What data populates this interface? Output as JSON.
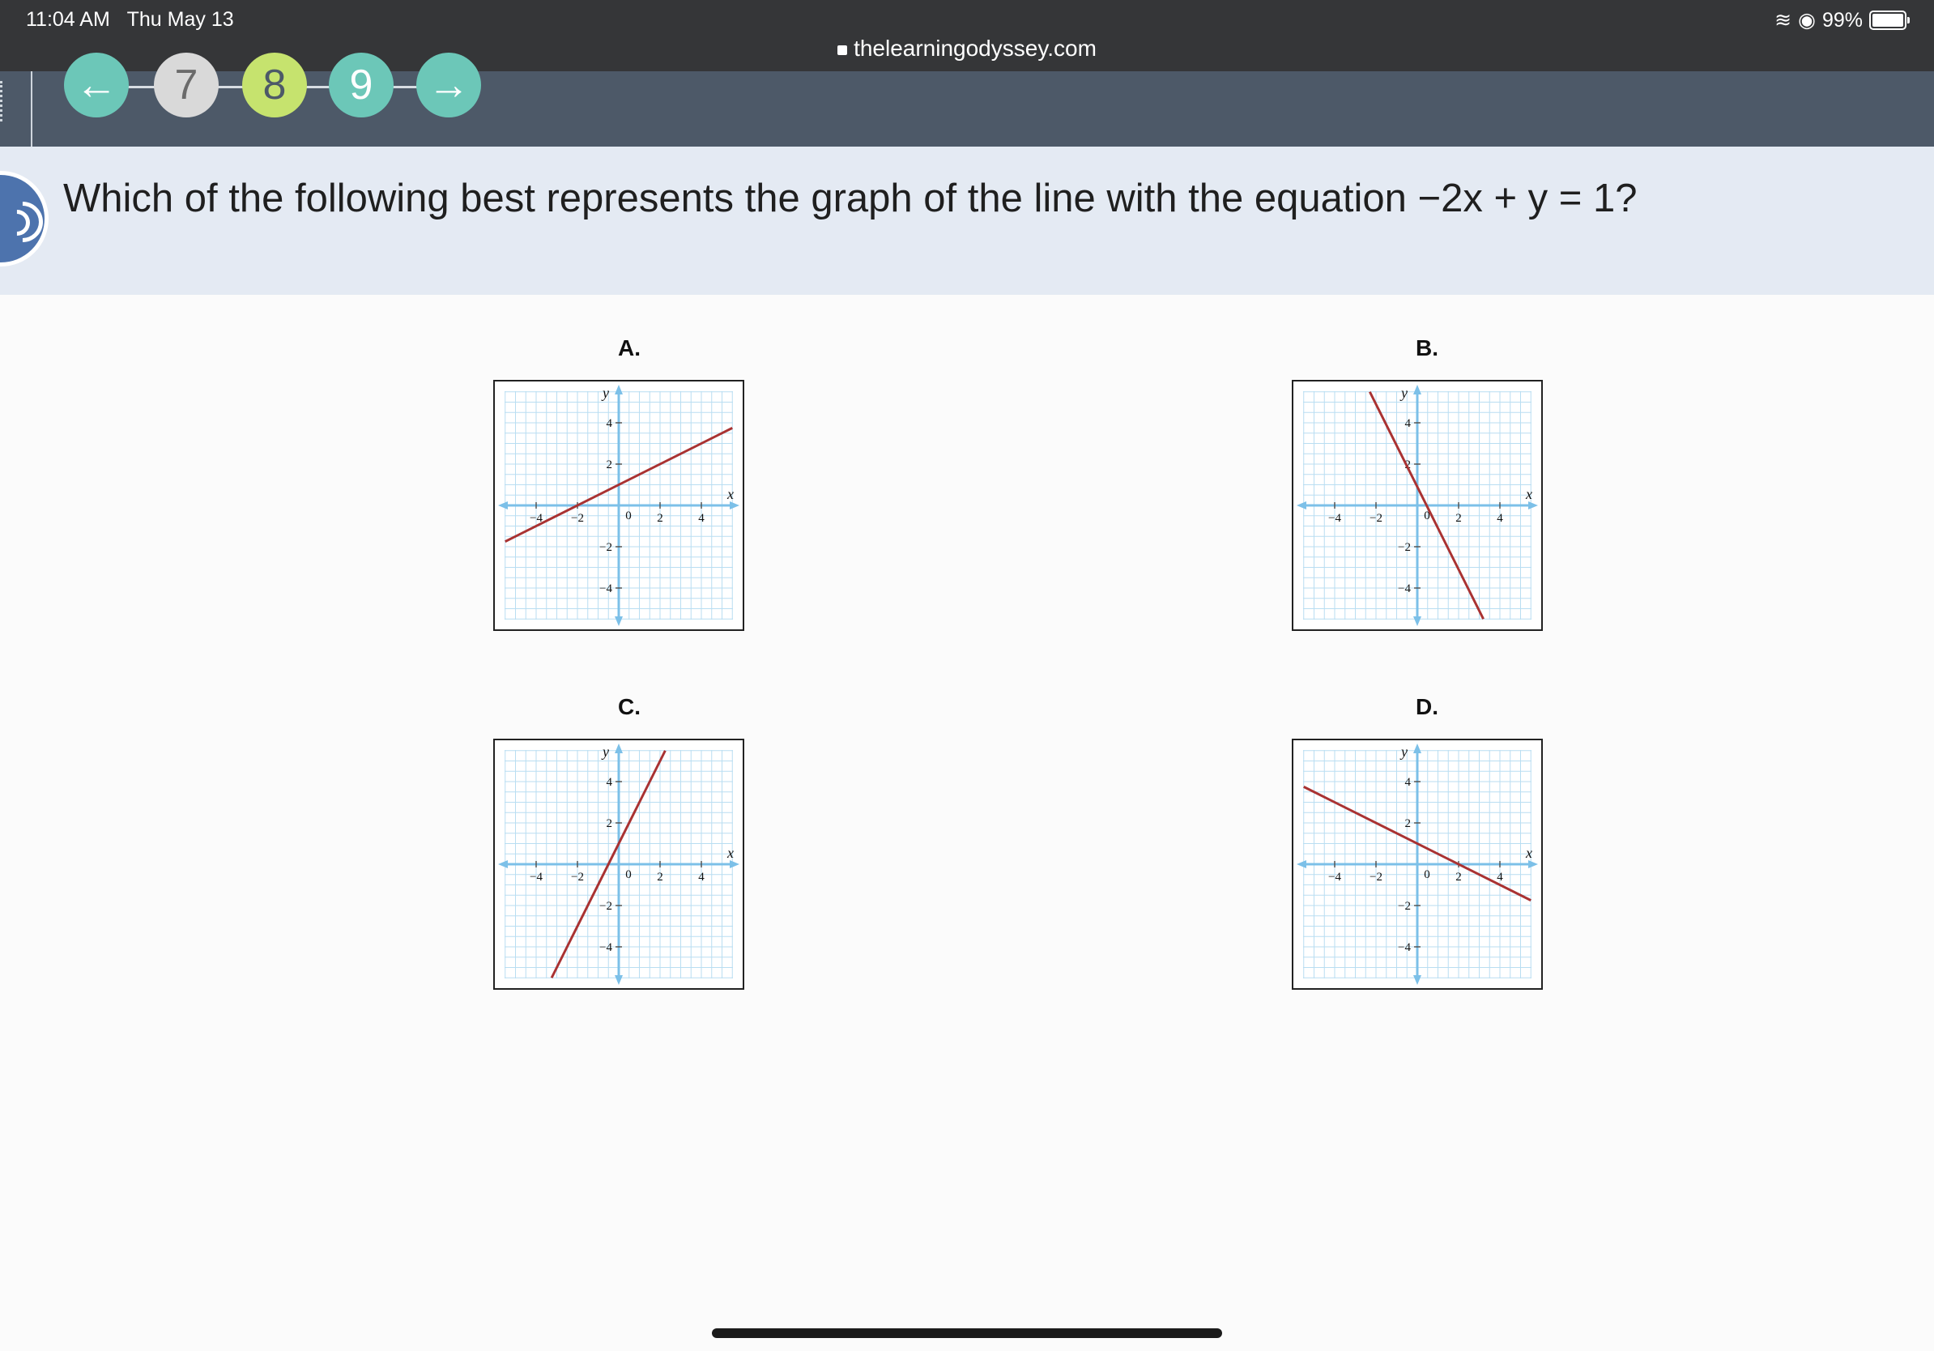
{
  "status": {
    "time": "11:04 AM",
    "date": "Thu May 13",
    "battery": "99%",
    "url": "thelearningodyssey.com"
  },
  "nav": {
    "steps": [
      {
        "label": "←",
        "kind": "back"
      },
      {
        "label": "7"
      },
      {
        "label": "8"
      },
      {
        "label": "9"
      },
      {
        "label": "→",
        "kind": "forward"
      }
    ]
  },
  "question": {
    "text": "Which of the following best represents the graph of the line with the equation −2x + y = 1?"
  },
  "choices": [
    {
      "label": "A.",
      "line": {
        "x": [
          -5.5,
          5.5
        ],
        "y": [
          -1.75,
          3.75
        ]
      }
    },
    {
      "label": "B.",
      "line": {
        "x": [
          -2.3,
          3.2
        ],
        "y": [
          5.5,
          -5.5
        ]
      }
    },
    {
      "label": "C.",
      "line": {
        "x": [
          -3.25,
          2.25
        ],
        "y": [
          -5.5,
          5.5
        ]
      }
    },
    {
      "label": "D.",
      "line": {
        "x": [
          -5.5,
          5.5
        ],
        "y": [
          3.75,
          -1.75
        ]
      }
    }
  ],
  "graph_axis": {
    "x_label": "x",
    "y_label": "y",
    "ticks": [
      "−4",
      "−2",
      "2",
      "4"
    ],
    "origin": "0",
    "xlim": [
      -6,
      6
    ],
    "ylim": [
      -6,
      6
    ]
  },
  "colors": {
    "line": "#a93232",
    "axis": "#7cc0e8",
    "grid": "#b9def2",
    "nav_bg": "#4d5968",
    "question_bg": "#e4eaf3"
  }
}
